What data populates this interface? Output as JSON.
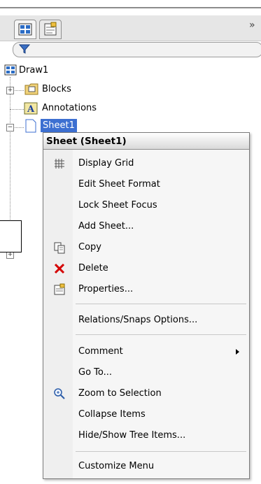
{
  "panel": {
    "expand_chevrons": "»"
  },
  "tree": {
    "root": "Draw1",
    "items": [
      "Blocks",
      "Annotations",
      "Sheet1"
    ]
  },
  "context_menu": {
    "title": "Sheet (Sheet1)",
    "items": {
      "display_grid": "Display Grid",
      "edit_sheet_format": "Edit Sheet Format",
      "lock_sheet_focus": "Lock Sheet Focus",
      "add_sheet": "Add Sheet...",
      "copy": "Copy",
      "delete": "Delete",
      "properties": "Properties...",
      "relations_snaps": "Relations/Snaps Options...",
      "comment": "Comment",
      "go_to": "Go To...",
      "zoom_to_selection": "Zoom to Selection",
      "collapse_items": "Collapse Items",
      "hide_show_tree": "Hide/Show Tree Items...",
      "customize_menu": "Customize Menu"
    }
  },
  "colors": {
    "selection": "#3c6fd1",
    "delete_icon": "#d40000",
    "header_gray": "#d9d9d9"
  }
}
